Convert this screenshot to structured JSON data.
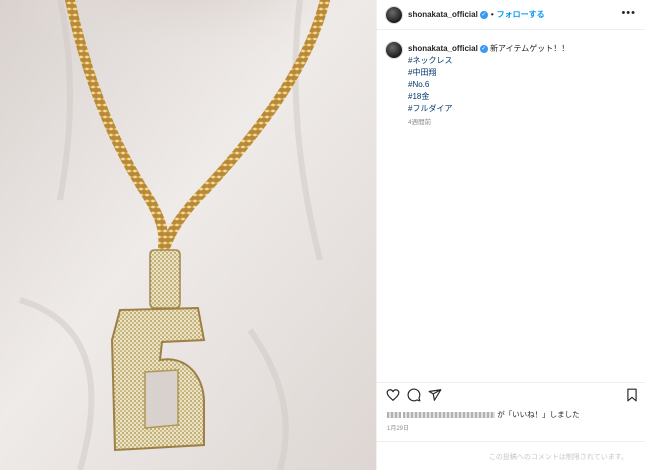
{
  "post": {
    "username": "shonakata_official",
    "follow_label": "フォローする",
    "more_label": "•••",
    "caption_text": "新アイテムゲット！！",
    "hashtags": [
      "#ネックレス",
      "#中田翔",
      "#No.6",
      "#18金",
      "#フルダイア"
    ],
    "time_ago": "4週間前",
    "pendant_number": "6",
    "likes_suffix": "が「いいね！」しました",
    "date": "1月29日",
    "comments_restricted": "この投稿へのコメントは制限されています。"
  },
  "icons": [
    "heart-icon",
    "comment-icon",
    "share-icon",
    "bookmark-icon",
    "verified-icon",
    "more-icon"
  ],
  "colors": {
    "link": "#0095f6",
    "hashtag": "#00376b",
    "muted": "#8e8e8e",
    "border": "#efefef",
    "gold": "#c9a24a"
  }
}
